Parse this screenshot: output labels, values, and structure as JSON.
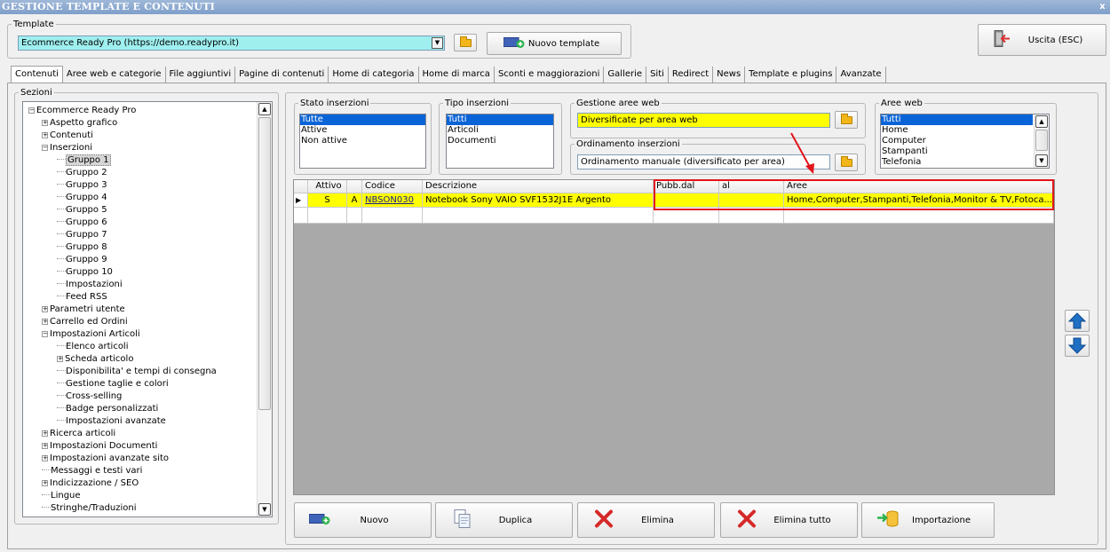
{
  "window": {
    "title": "GESTIONE TEMPLATE E CONTENUTI",
    "close_label": "x"
  },
  "template": {
    "legend": "Template",
    "selected": "Ecommerce Ready Pro (https://demo.readypro.it)",
    "new_button": "Nuovo template"
  },
  "exit_button": "Uscita (ESC)",
  "tabs": [
    "Contenuti",
    "Aree web e categorie",
    "File aggiuntivi",
    "Pagine di contenuti",
    "Home di categoria",
    "Home di marca",
    "Sconti e maggiorazioni",
    "Gallerie",
    "Siti",
    "Redirect",
    "News",
    "Template e plugins",
    "Avanzate"
  ],
  "sections": {
    "legend": "Sezioni",
    "tree": [
      {
        "label": "Ecommerce Ready Pro",
        "level": 0,
        "expander": "minus"
      },
      {
        "label": "Aspetto grafico",
        "level": 1,
        "expander": "plus"
      },
      {
        "label": "Contenuti",
        "level": 1,
        "expander": "plus"
      },
      {
        "label": "Inserzioni",
        "level": 1,
        "expander": "minus"
      },
      {
        "label": "Gruppo 1",
        "level": 2,
        "expander": "",
        "selected": true
      },
      {
        "label": "Gruppo 2",
        "level": 2,
        "expander": ""
      },
      {
        "label": "Gruppo 3",
        "level": 2,
        "expander": ""
      },
      {
        "label": "Gruppo 4",
        "level": 2,
        "expander": ""
      },
      {
        "label": "Gruppo 5",
        "level": 2,
        "expander": ""
      },
      {
        "label": "Gruppo 6",
        "level": 2,
        "expander": ""
      },
      {
        "label": "Gruppo 7",
        "level": 2,
        "expander": ""
      },
      {
        "label": "Gruppo 8",
        "level": 2,
        "expander": ""
      },
      {
        "label": "Gruppo 9",
        "level": 2,
        "expander": ""
      },
      {
        "label": "Gruppo 10",
        "level": 2,
        "expander": ""
      },
      {
        "label": "Impostazioni",
        "level": 2,
        "expander": ""
      },
      {
        "label": "Feed RSS",
        "level": 2,
        "expander": ""
      },
      {
        "label": "Parametri utente",
        "level": 1,
        "expander": "plus"
      },
      {
        "label": "Carrello ed Ordini",
        "level": 1,
        "expander": "plus"
      },
      {
        "label": "Impostazioni Articoli",
        "level": 1,
        "expander": "minus"
      },
      {
        "label": "Elenco articoli",
        "level": 2,
        "expander": ""
      },
      {
        "label": "Scheda articolo",
        "level": 2,
        "expander": "plus"
      },
      {
        "label": "Disponibilita' e tempi di consegna",
        "level": 2,
        "expander": ""
      },
      {
        "label": "Gestione taglie e colori",
        "level": 2,
        "expander": ""
      },
      {
        "label": "Cross-selling",
        "level": 2,
        "expander": ""
      },
      {
        "label": "Badge personalizzati",
        "level": 2,
        "expander": ""
      },
      {
        "label": "Impostazioni avanzate",
        "level": 2,
        "expander": ""
      },
      {
        "label": "Ricerca articoli",
        "level": 1,
        "expander": "plus"
      },
      {
        "label": "Impostazioni Documenti",
        "level": 1,
        "expander": "plus"
      },
      {
        "label": "Impostazioni avanzate sito",
        "level": 1,
        "expander": "plus"
      },
      {
        "label": "Messaggi e testi vari",
        "level": 1,
        "expander": ""
      },
      {
        "label": "Indicizzazione / SEO",
        "level": 1,
        "expander": "plus"
      },
      {
        "label": "Lingue",
        "level": 1,
        "expander": ""
      },
      {
        "label": "Stringhe/Traduzioni",
        "level": 1,
        "expander": ""
      }
    ]
  },
  "stato": {
    "legend": "Stato inserzioni",
    "items": [
      "Tutte",
      "Attive",
      "Non attive"
    ],
    "selected": 0
  },
  "tipo": {
    "legend": "Tipo inserzioni",
    "items": [
      "Tutti",
      "Articoli",
      "Documenti"
    ],
    "selected": 0
  },
  "gestione_aree": {
    "legend": "Gestione aree web",
    "value": "Diversificate per area web",
    "highlight": "#ffff00"
  },
  "ordinamento": {
    "legend": "Ordinamento inserzioni",
    "value": "Ordinamento manuale (diversificato per area)"
  },
  "aree_web": {
    "legend": "Aree web",
    "items": [
      "Tutti",
      "Home",
      "Computer",
      "Stampanti",
      "Telefonia"
    ],
    "selected": 0
  },
  "grid": {
    "columns": [
      "",
      "Attivo",
      "",
      "Codice",
      "Descrizione",
      "Pubb.dal",
      "al",
      "Aree"
    ],
    "rows": [
      {
        "marker": "▶",
        "attivo": "S",
        "flag": "A",
        "codice": "NBSON030",
        "descrizione": "Notebook Sony VAIO SVF1532J1E Argento",
        "pubb_dal": "",
        "al": "",
        "aree": "Home,Computer,Stampanti,Telefonia,Monitor & TV,Fotoca..."
      }
    ],
    "row_color": "#ffff00"
  },
  "actions": {
    "nuovo": "Nuovo",
    "duplica": "Duplica",
    "elimina": "Elimina",
    "elimina_tutto": "Elimina tutto",
    "importazione": "Importazione"
  },
  "colors": {
    "accent_red": "#e2141b",
    "move_arrow": "#1f6fc5",
    "selection": "#0a64d8"
  },
  "icons": [
    "folder-icon",
    "add-template-icon",
    "exit-door-icon",
    "new-item-icon",
    "duplicate-icon",
    "delete-x-icon",
    "import-icon",
    "move-up-icon",
    "move-down-icon"
  ]
}
